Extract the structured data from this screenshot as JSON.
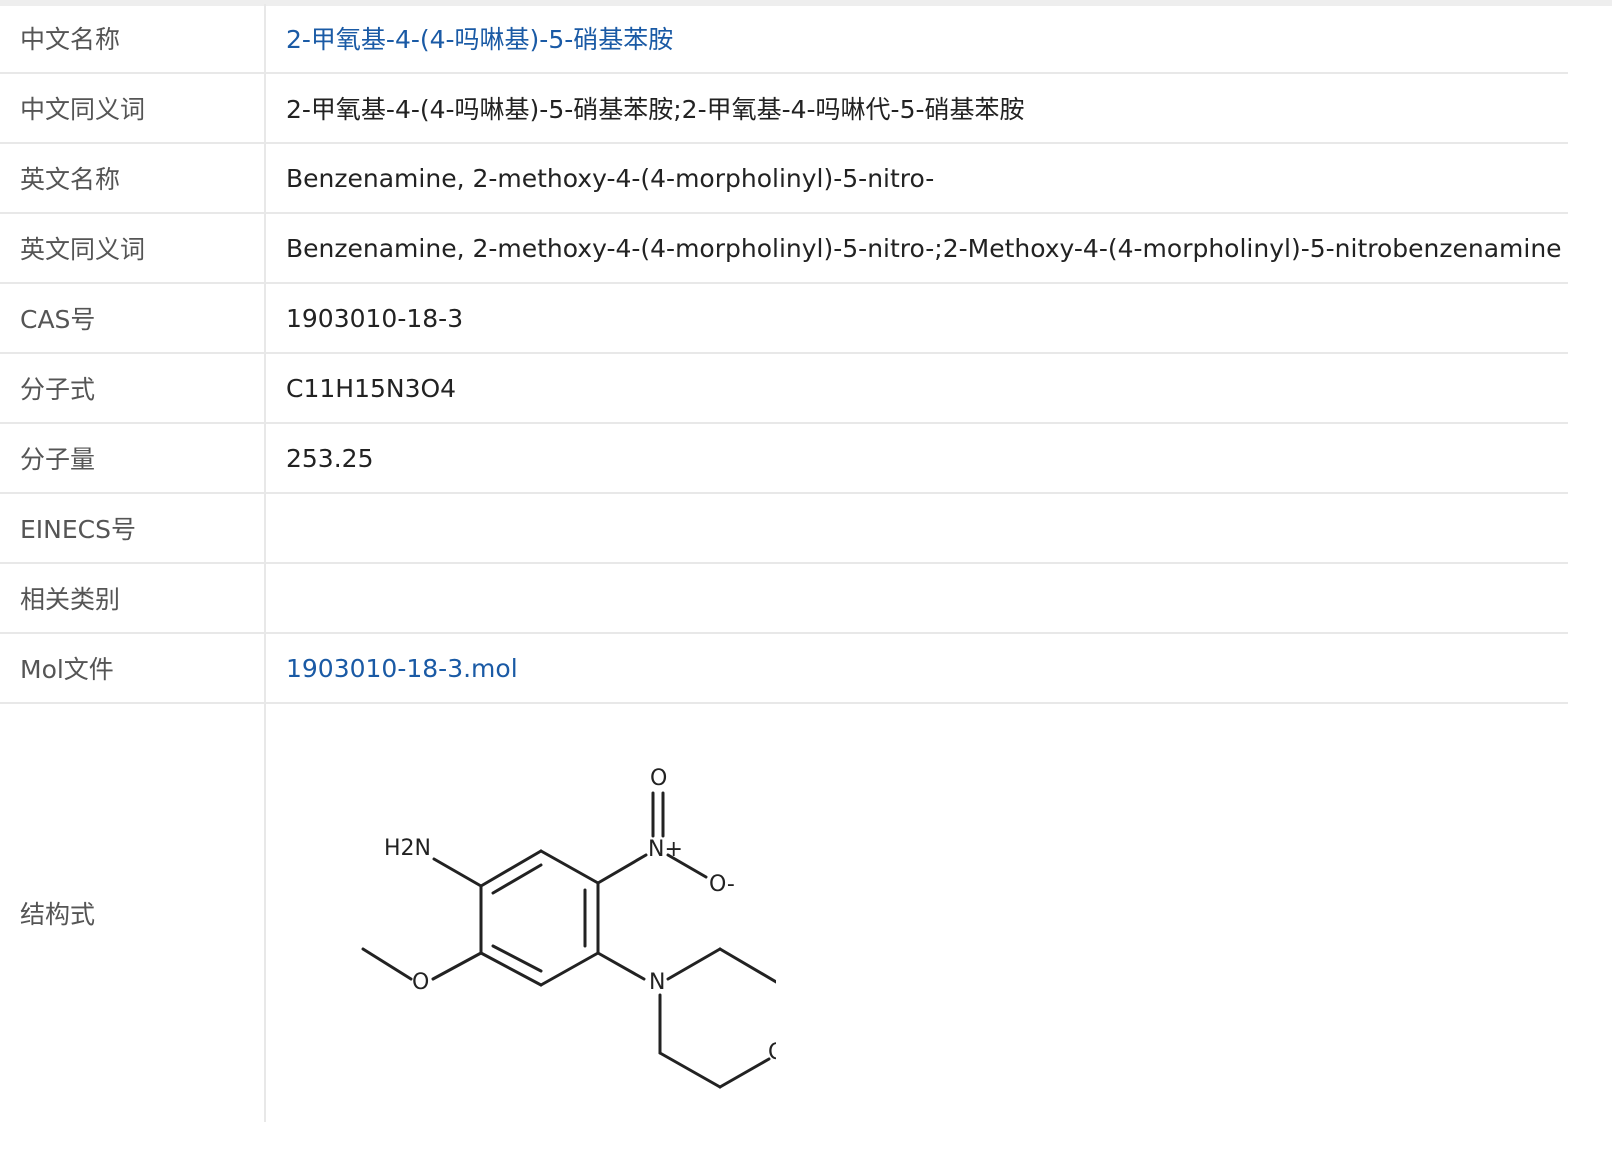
{
  "rows": [
    {
      "label": "中文名称",
      "value": "2-甲氧基-4-(4-吗啉基)-5-硝基苯胺",
      "link": true
    },
    {
      "label": "中文同义词",
      "value": "2-甲氧基-4-(4-吗啉基)-5-硝基苯胺;2-甲氧基-4-吗啉代-5-硝基苯胺",
      "link": false
    },
    {
      "label": "英文名称",
      "value": "Benzenamine, 2-methoxy-4-(4-morpholinyl)-5-nitro-",
      "link": false
    },
    {
      "label": "英文同义词",
      "value": "Benzenamine, 2-methoxy-4-(4-morpholinyl)-5-nitro-;2-Methoxy-4-(4-morpholinyl)-5-nitrobenzenamine",
      "link": false
    },
    {
      "label": "CAS号",
      "value": "1903010-18-3",
      "link": false
    },
    {
      "label": "分子式",
      "value": "C11H15N3O4",
      "link": false
    },
    {
      "label": "分子量",
      "value": "253.25",
      "link": false
    },
    {
      "label": "EINECS号",
      "value": "",
      "link": false
    },
    {
      "label": "相关类别",
      "value": "",
      "link": false
    },
    {
      "label": "Mol文件",
      "value": "1903010-18-3.mol",
      "link": true
    }
  ],
  "structure": {
    "label": "结构式",
    "atoms": {
      "amine": "H2N",
      "nitro_n": "N+",
      "nitro_o_top": "O",
      "nitro_o_minus": "O-",
      "methoxy_o": "O",
      "morpholine_n": "N",
      "morpholine_o": "O"
    }
  }
}
